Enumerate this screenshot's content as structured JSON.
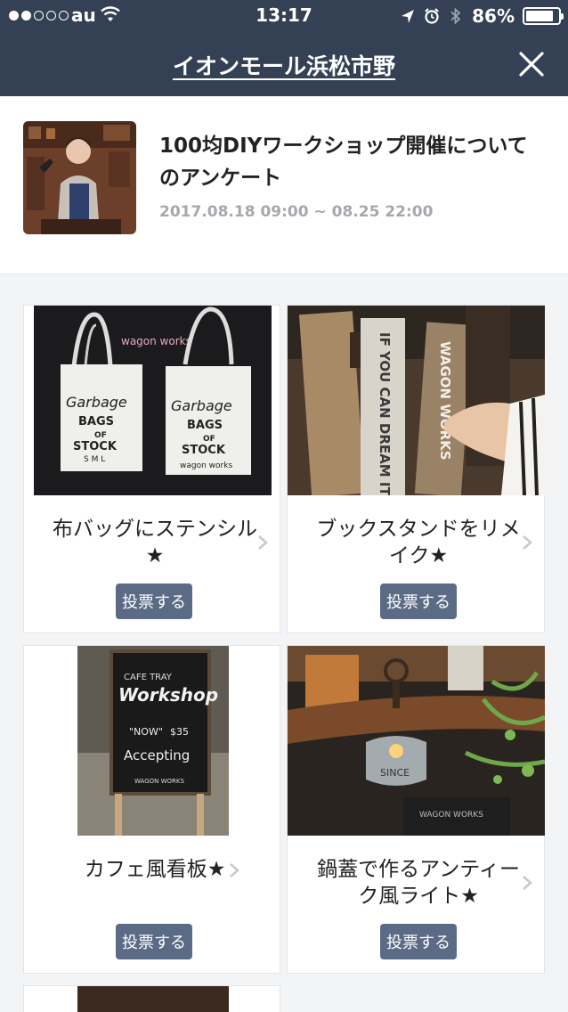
{
  "status_bar": {
    "carrier": "au",
    "time": "13:17",
    "battery_percent": "86%",
    "battery_level": 0.86,
    "icons": [
      "signal-dots",
      "wifi-icon",
      "location-arrow-icon",
      "alarm-icon",
      "bluetooth-icon",
      "battery-icon"
    ]
  },
  "nav": {
    "title": "イオンモール浜松市野",
    "close_icon": "close-icon"
  },
  "survey": {
    "title": "100均DIYワークショップ開催についてのアンケート",
    "period": "2017.08.18 09:00 ~ 08.25 22:00"
  },
  "options": [
    {
      "label": "布バッグにステンシル★",
      "vote_label": "投票する",
      "image_text": [
        "wagon works",
        "Garbage",
        "BAGS",
        "OF",
        "STOCK",
        "S M L",
        "wagon works"
      ]
    },
    {
      "label": "ブックスタンドをリメイク★",
      "vote_label": "投票する",
      "image_text": [
        "IF YOU CAN DREAM IT",
        "WAGON WORKS"
      ]
    },
    {
      "label": "カフェ風看板★",
      "vote_label": "投票する",
      "image_text": [
        "CAFE TRAY",
        "Workshop",
        "\"NOW\"",
        "$35",
        "Accepting",
        "WAGON WORKS"
      ]
    },
    {
      "label": "鍋蓋で作るアンティーク風ライト★",
      "vote_label": "投票する",
      "image_text": [
        "SINCE",
        "WAGON WORKS"
      ]
    }
  ],
  "colors": {
    "nav_bg": "#344054",
    "vote_button_bg": "#5b6b86",
    "page_bg": "#f3f4f6"
  }
}
